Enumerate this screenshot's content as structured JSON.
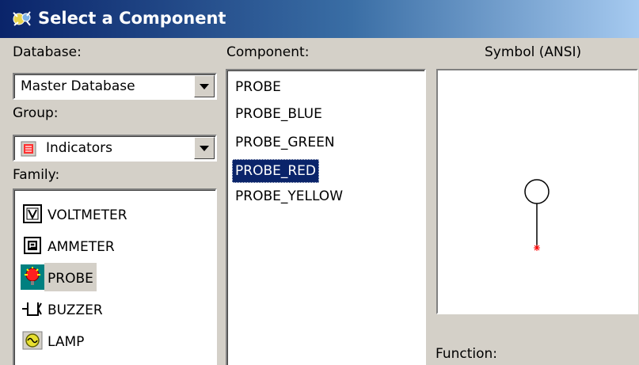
{
  "window": {
    "title": "Select a Component",
    "title_icon": "component-wizard-icon"
  },
  "database": {
    "label": "Database:",
    "selected": "Master Database"
  },
  "group": {
    "label": "Group:",
    "selected": "Indicators",
    "icon": "indicator-icon"
  },
  "family": {
    "label": "Family:",
    "items": [
      {
        "label": "VOLTMETER",
        "icon": "voltmeter-icon"
      },
      {
        "label": "AMMETER",
        "icon": "ammeter-icon"
      },
      {
        "label": "PROBE",
        "icon": "probe-icon",
        "selected": true
      },
      {
        "label": "BUZZER",
        "icon": "buzzer-icon"
      },
      {
        "label": "LAMP",
        "icon": "lamp-icon"
      }
    ]
  },
  "component": {
    "label": "Component:",
    "items": [
      "PROBE",
      "PROBE_BLUE",
      "PROBE_GREEN",
      "PROBE_RED",
      "PROBE_YELLOW"
    ],
    "selected": "PROBE_RED"
  },
  "symbol": {
    "label": "Symbol (ANSI)"
  },
  "function": {
    "label": "Function:"
  },
  "colors": {
    "title_start": "#0a246a",
    "title_end": "#a6caf0",
    "selection": "#0a246a",
    "dialog_bg": "#d4d0c8",
    "probe_mark": "#ff0000"
  }
}
